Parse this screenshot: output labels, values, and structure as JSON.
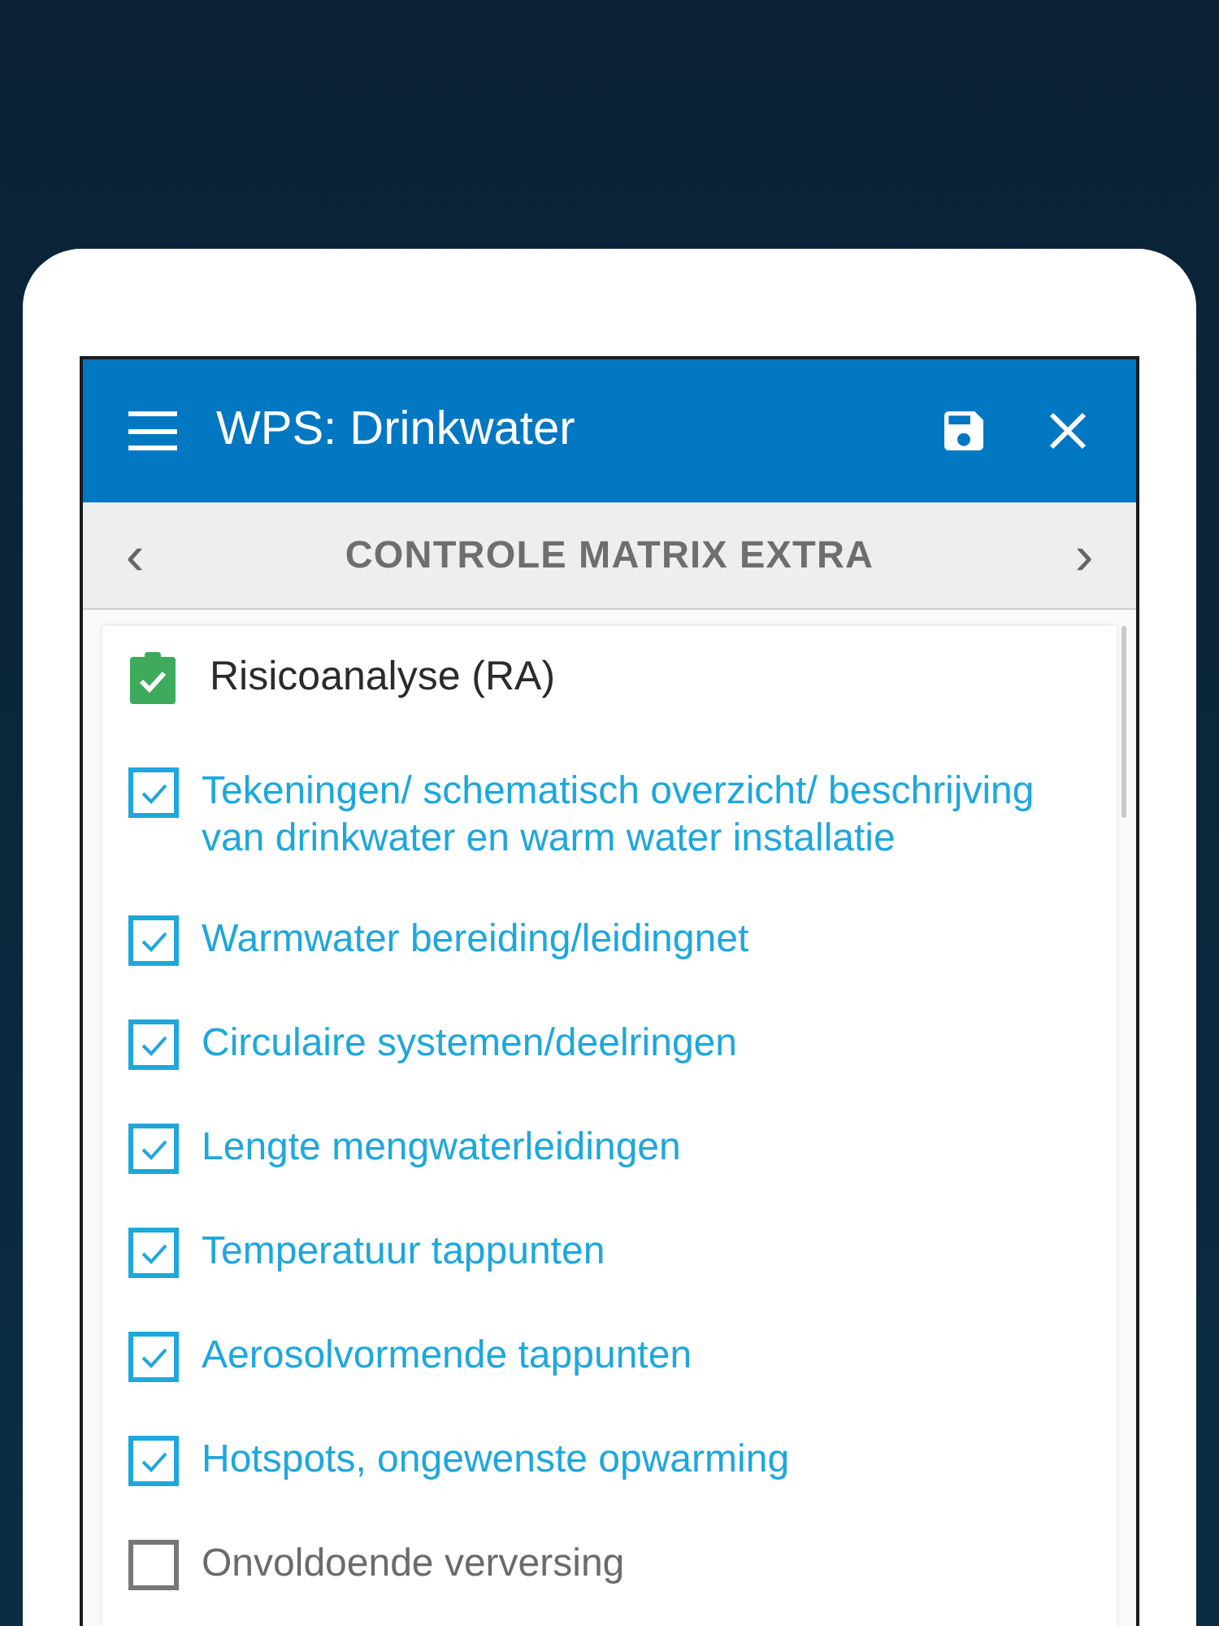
{
  "app_bar": {
    "title": "WPS: Drinkwater"
  },
  "pager": {
    "title": "CONTROLE MATRIX EXTRA",
    "prev": "‹",
    "next": "›"
  },
  "section": {
    "title": "Risicoanalyse (RA)",
    "complete": true
  },
  "items": [
    {
      "label": "Tekeningen/ schematisch overzicht/ beschrijving van drinkwater en warm water installatie",
      "checked": true
    },
    {
      "label": "Warmwater bereiding/leidingnet",
      "checked": true
    },
    {
      "label": "Circulaire systemen/deelringen",
      "checked": true
    },
    {
      "label": "Lengte mengwaterleidingen",
      "checked": true
    },
    {
      "label": "Temperatuur tappunten",
      "checked": true
    },
    {
      "label": "Aerosolvormende tappunten",
      "checked": true
    },
    {
      "label": "Hotspots, ongewenste opwarming",
      "checked": true
    },
    {
      "label": "Onvoldoende verversing",
      "checked": false
    }
  ]
}
